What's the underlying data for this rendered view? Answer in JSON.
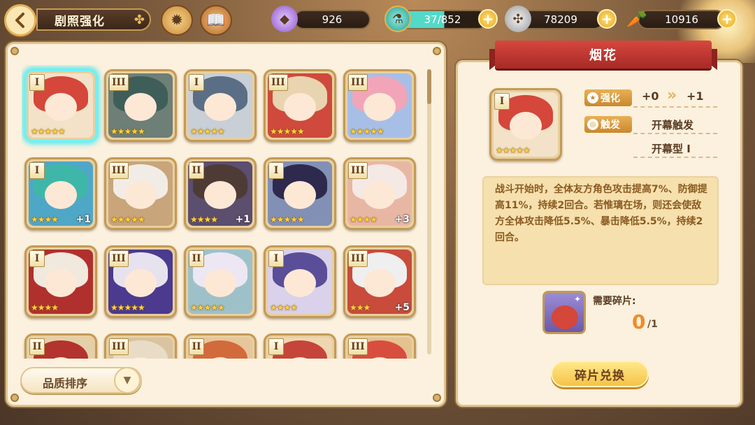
{
  "header": {
    "title": "剧照强化",
    "resources": [
      {
        "icon": "crystal-icon",
        "value": "926"
      },
      {
        "icon": "potion-icon",
        "value": "37/852"
      },
      {
        "icon": "coin-icon",
        "value": "78209"
      },
      {
        "icon": "carrot-icon",
        "value": "10916"
      }
    ]
  },
  "grid": {
    "cards": [
      {
        "rank": "I",
        "stars": "★★★★★",
        "plus": "",
        "hair": "#d4473a",
        "bg": "#f3e2c8"
      },
      {
        "rank": "III",
        "stars": "★★★★★",
        "plus": "",
        "hair": "#3f5e5a",
        "bg": "#6d7f76"
      },
      {
        "rank": "I",
        "stars": "★★★★★",
        "plus": "",
        "hair": "#5a6f85",
        "bg": "#c9cfd6"
      },
      {
        "rank": "III",
        "stars": "★★★★★",
        "plus": "",
        "hair": "#e9d4b0",
        "bg": "#cf4a3c"
      },
      {
        "rank": "III",
        "stars": "★★★★★",
        "plus": "",
        "hair": "#f2a5b8",
        "bg": "#a7bfe6"
      },
      {
        "rank": "I",
        "stars": "★★★★",
        "plus": "+1",
        "hair": "#3fb7a8",
        "bg": "#4fa7c7"
      },
      {
        "rank": "III",
        "stars": "★★★★★",
        "plus": "",
        "hair": "#f1ede6",
        "bg": "#c8a57b"
      },
      {
        "rank": "II",
        "stars": "★★★★",
        "plus": "+1",
        "hair": "#4e3b35",
        "bg": "#5b4e6e"
      },
      {
        "rank": "I",
        "stars": "★★★★★",
        "plus": "",
        "hair": "#2d2a4d",
        "bg": "#8390b5"
      },
      {
        "rank": "III",
        "stars": "★★★★",
        "plus": "+3",
        "hair": "#f4e9e4",
        "bg": "#e8b7a4"
      },
      {
        "rank": "I",
        "stars": "★★★★",
        "plus": "",
        "hair": "#f1e8de",
        "bg": "#b0302d"
      },
      {
        "rank": "III",
        "stars": "★★★★★",
        "plus": "",
        "hair": "#e6e3ef",
        "bg": "#4b3a8e"
      },
      {
        "rank": "II",
        "stars": "★★★★★",
        "plus": "",
        "hair": "#ece7f2",
        "bg": "#9ec1c9"
      },
      {
        "rank": "I",
        "stars": "★★★★",
        "plus": "",
        "hair": "#5a4e98",
        "bg": "#dad1ea"
      },
      {
        "rank": "III",
        "stars": "★★★",
        "plus": "+5",
        "hair": "#f0efef",
        "bg": "#c84b3b"
      },
      {
        "rank": "II",
        "stars": "",
        "plus": "",
        "hair": "#b3332e",
        "bg": "#e5cfa9"
      },
      {
        "rank": "III",
        "stars": "",
        "plus": "",
        "hair": "#e9dcc6",
        "bg": "#d9c3a0"
      },
      {
        "rank": "II",
        "stars": "",
        "plus": "",
        "hair": "#d26b3c",
        "bg": "#e8c69b"
      },
      {
        "rank": "I",
        "stars": "",
        "plus": "",
        "hair": "#c5453a",
        "bg": "#f0d6b0"
      },
      {
        "rank": "III",
        "stars": "",
        "plus": "",
        "hair": "#d84e3e",
        "bg": "#e5c190"
      }
    ]
  },
  "sort": {
    "label": "品质排序"
  },
  "detail": {
    "name": "烟花",
    "card": {
      "rank": "I",
      "stars": "★★★★★"
    },
    "enhance_label": "强化",
    "enhance_from": "+0",
    "enhance_arrow": "»",
    "enhance_to": "+1",
    "trigger_label": "触发",
    "trigger_value": "开幕触发",
    "type_value": "开幕型 I",
    "description": "战斗开始时，全体友方角色攻击提高7%、防御提高11%，持续2回合。若惟璃在场，则还会使敌方全体攻击降低5.5%、暴击降低5.5%，持续2回合。",
    "fragments_label": "需要碎片:",
    "fragments_have": "0",
    "fragments_need": "/1",
    "exchange_button": "碎片兑换"
  },
  "colors": {
    "accent": "#d6473f",
    "gold": "#f5c347",
    "panel": "#fbf1de",
    "highlight": "#6ef2f5"
  }
}
